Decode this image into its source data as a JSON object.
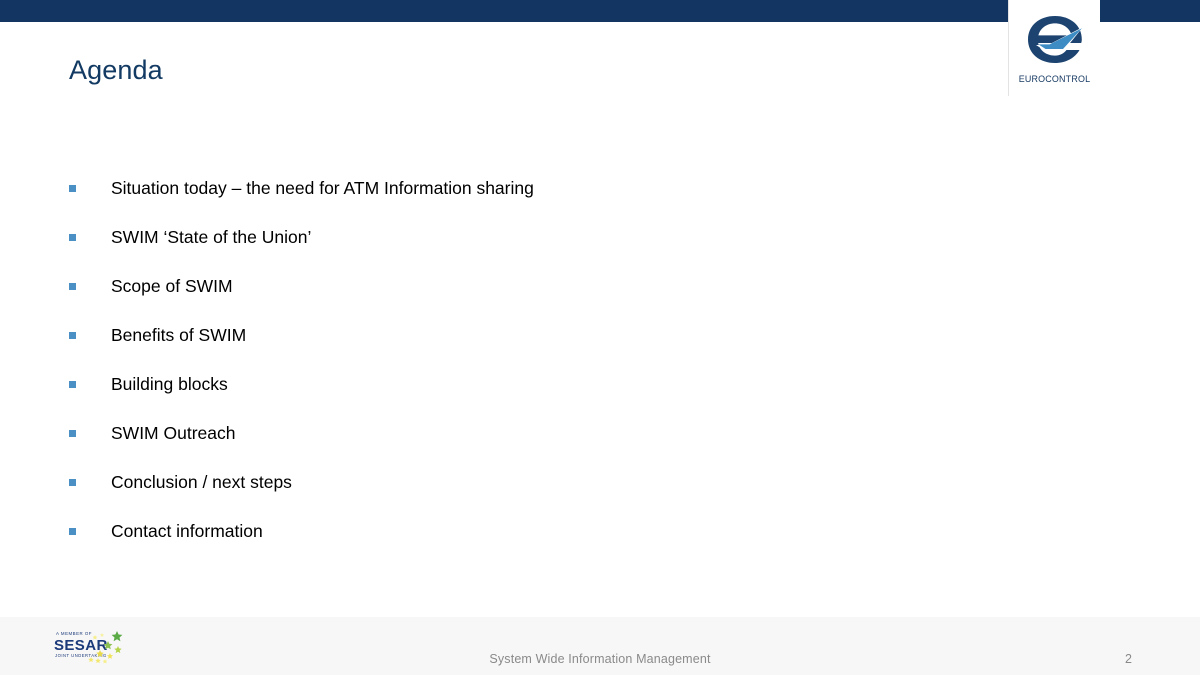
{
  "slide": {
    "title": "Agenda",
    "page_number": "2",
    "accent_navy": "#123562",
    "bullet_blue": "#4a90c4",
    "title_color": "#123a63",
    "footer_band_color": "#f7f7f7",
    "footer_text_color": "#8a8a8a"
  },
  "brand": {
    "eurocontrol_wordmark": "EUROCONTROL",
    "eurocontrol_mark_name": "eurocontrol-e-swoosh-logo"
  },
  "agenda": {
    "items": [
      {
        "label": "Situation today – the need for ATM Information sharing"
      },
      {
        "label": "SWIM ‘State of the Union’"
      },
      {
        "label": "Scope of SWIM"
      },
      {
        "label": "Benefits of SWIM"
      },
      {
        "label": "Building blocks"
      },
      {
        "label": "SWIM Outreach"
      },
      {
        "label": "Conclusion / next steps"
      },
      {
        "label": "Contact information"
      }
    ]
  },
  "footer": {
    "center_text": "System Wide Information Management",
    "page_number": "2",
    "sesar": {
      "member_of": "A MEMBER OF",
      "name": "SESAR",
      "subtitle": "JOINT UNDERTAKING",
      "blue": "#1b3a7a",
      "star_green": "#5aaa46",
      "star_yellow": "#e8d94a"
    }
  }
}
